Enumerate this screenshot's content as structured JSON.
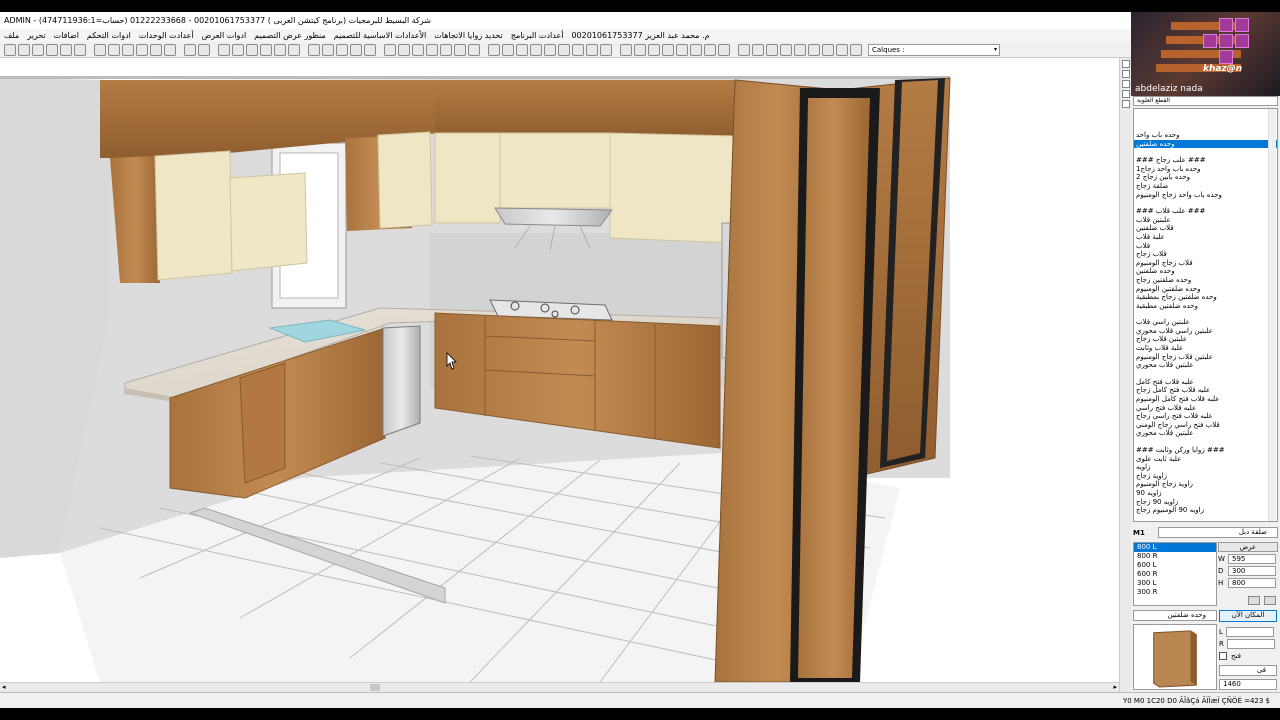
{
  "window": {
    "title": "ADMIN - شركة البسيط للبرمجيات (برنامج كيتشن العربى ) 00201061753377 - 01222233668 (حساب=474711936:1)"
  },
  "menubar": {
    "items": [
      "ملف",
      "تحرير",
      "اضافات",
      "ادوات التحكم",
      "أعدادت الوحدات",
      "ادوات العرض",
      "منظور عرض التصميم",
      "الأعدادات الاساسية للتصميم",
      "تحديد زوايا الاتجاهات",
      "أعدادت البرنامج",
      "م. محمد عبد العزيز 00201061753377"
    ]
  },
  "toolbar": {
    "calques_label": "Calques :"
  },
  "webcam": {
    "logo_text": "khaz@n",
    "name": "abdelaziz nada"
  },
  "catalog": {
    "category_value": "القطع العلوية",
    "items": [
      {
        "label": "وحده باب واحد",
        "selected": false
      },
      {
        "label": "وحده ضلفتين",
        "selected": true
      },
      {
        "label": "",
        "selected": false
      },
      {
        "label": "### علب زجاج ###",
        "selected": false
      },
      {
        "label": "وحده باب واحد زجاج1",
        "selected": false
      },
      {
        "label": "وحده بابين زجاج 2",
        "selected": false
      },
      {
        "label": "ضلفة زجاج",
        "selected": false
      },
      {
        "label": "وحده باب واحد زجاج الومنيوم",
        "selected": false
      },
      {
        "label": "",
        "selected": false
      },
      {
        "label": "### علب قلاب ###",
        "selected": false
      },
      {
        "label": "علبتين قلاب",
        "selected": false
      },
      {
        "label": "قلاب ضلفتين",
        "selected": false
      },
      {
        "label": "علبة قلاب",
        "selected": false
      },
      {
        "label": "قلاب",
        "selected": false
      },
      {
        "label": "قلاب زجاج",
        "selected": false
      },
      {
        "label": "قلاب زجاج الومنيوم",
        "selected": false
      },
      {
        "label": "وحده ضلفتين",
        "selected": false
      },
      {
        "label": "وحده ضلفتين زجاج",
        "selected": false
      },
      {
        "label": "وحده ضلفتين الومنيوم",
        "selected": false
      },
      {
        "label": "وحده ضلفتين زجاج بمطبقية",
        "selected": false
      },
      {
        "label": "وحده ضلفتين مطبقية",
        "selected": false
      },
      {
        "label": "",
        "selected": false
      },
      {
        "label": "علبتين راسي قلاب",
        "selected": false
      },
      {
        "label": "علبتين راسي قلاب محوري",
        "selected": false
      },
      {
        "label": "علبتين قلاب زجاج",
        "selected": false
      },
      {
        "label": "علبة قلاب وثابت",
        "selected": false
      },
      {
        "label": "علبتين قلاب زجاج الومنيوم",
        "selected": false
      },
      {
        "label": "علبتين قلاب محوري",
        "selected": false
      },
      {
        "label": "",
        "selected": false
      },
      {
        "label": "علبه قلاب فتح كامل",
        "selected": false
      },
      {
        "label": "علبه قلاب فتح كامل زجاج",
        "selected": false
      },
      {
        "label": "علبه قلاب فتح كامل الومنيوم",
        "selected": false
      },
      {
        "label": "علبه قلاب فتح راسي",
        "selected": false
      },
      {
        "label": "علبه قلاب فتح راسي زجاج",
        "selected": false
      },
      {
        "label": "قلاب فتح راسي زجاج الومني",
        "selected": false
      },
      {
        "label": "علبتين قلاب محوري",
        "selected": false
      },
      {
        "label": "",
        "selected": false
      },
      {
        "label": "### زوايا وركن وثابت ###",
        "selected": false
      },
      {
        "label": "علبة ثابت علوى",
        "selected": false
      },
      {
        "label": "زاويه",
        "selected": false
      },
      {
        "label": "زاوية زجاج",
        "selected": false
      },
      {
        "label": "زاوية زجاج الومنيوم",
        "selected": false
      },
      {
        "label": "زاويه 90",
        "selected": false
      },
      {
        "label": "زاويه 90 زجاج",
        "selected": false
      },
      {
        "label": "زاويه 90 الومنيوم زجاج",
        "selected": false
      }
    ]
  },
  "module": {
    "code": "M1",
    "type_value": "ضلفة دبل",
    "sizes": [
      {
        "label": "800 L",
        "selected": true
      },
      {
        "label": "800 R",
        "selected": false
      },
      {
        "label": "600 L",
        "selected": false
      },
      {
        "label": "600 R",
        "selected": false
      },
      {
        "label": "300 L",
        "selected": false
      },
      {
        "label": "300 R",
        "selected": false
      }
    ],
    "dim_title": "عرض",
    "W": "595",
    "D": "300",
    "H": "800",
    "unit_value": "وحده ضلفتين",
    "place_button": "المكان الآن",
    "L_label": "L",
    "R_label": "R",
    "open_label": "فتح",
    "finish_value": "فى",
    "number_value": "1460"
  },
  "status": {
    "text": "Y0 M0 1C20 D0 ÃÎãÇá ÃÏÏæÏ ÇÑÖÉ =423 $"
  }
}
